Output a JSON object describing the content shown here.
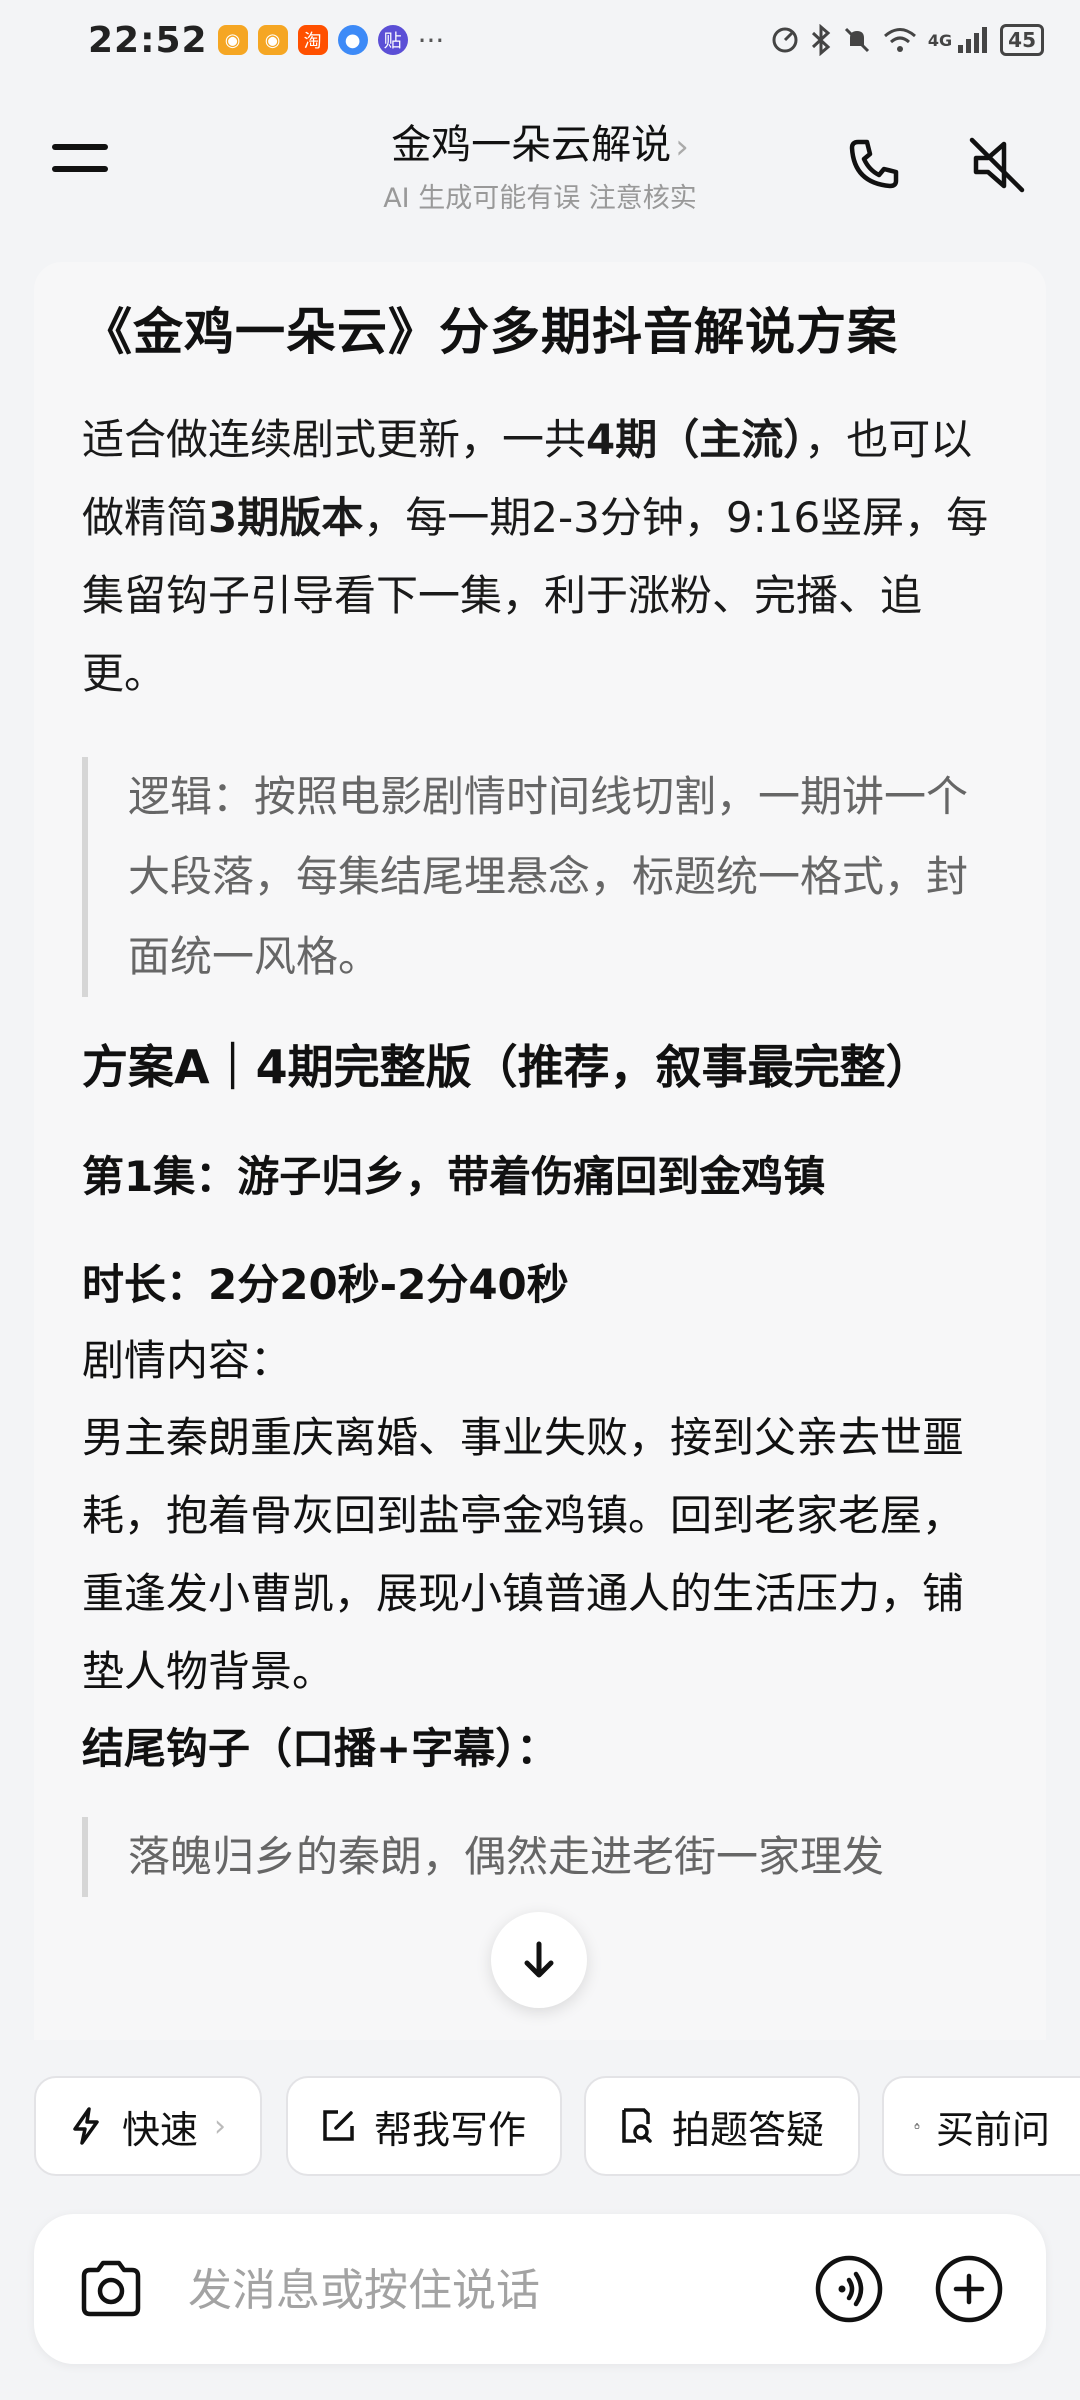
{
  "status_bar": {
    "time": "22:52",
    "notification_icons": [
      "weibo-icon",
      "weibo-icon",
      "taobao-icon",
      "browser-icon",
      "tieba-icon"
    ],
    "more": "···",
    "network": "4G",
    "battery": "45"
  },
  "header": {
    "title": "金鸡一朵云解说",
    "subtitle": "AI 生成可能有误 注意核实"
  },
  "message": {
    "title": "《金鸡一朵云》分多期抖音解说方案",
    "intro": {
      "p1": "适合做连续剧式更新，一共",
      "b1": "4期（主流）",
      "p2": "，也可以做精简",
      "b2": "3期版本",
      "p3": "，每一期2-3分钟，9:16竖屏，每集留钩子引导看下一集，利于涨粉、完播、追更。"
    },
    "quote": "逻辑：按照电影剧情时间线切割，一期讲一个大段落，每集结尾埋悬念，标题统一格式，封面统一风格。",
    "plan_heading": "方案A｜4期完整版（推荐，叙事最完整）",
    "episode_heading": "第1集：游子归乡，带着伤痛回到金鸡镇",
    "duration": "时长：2分20秒-2分40秒",
    "content_label": "剧情内容：",
    "content_body": "男主秦朗重庆离婚、事业失败，接到父亲去世噩耗，抱着骨灰回到盐亭金鸡镇。回到老家老屋，重逢发小曹凯，展现小镇普通人的生活压力，铺垫人物背景。",
    "hook_label": "结尾钩子（口播+字幕）：",
    "hook_quote": "落魄归乡的秦朗，偶然走进老街一家理发"
  },
  "quick_actions": [
    {
      "label": "快速",
      "icon": "lightning-icon"
    },
    {
      "label": "帮我写作",
      "icon": "edit-icon"
    },
    {
      "label": "拍题答疑",
      "icon": "scan-doc-icon"
    },
    {
      "label": "买前问",
      "icon": "shopping-bag-icon"
    }
  ],
  "input": {
    "placeholder": "发消息或按住说话"
  }
}
